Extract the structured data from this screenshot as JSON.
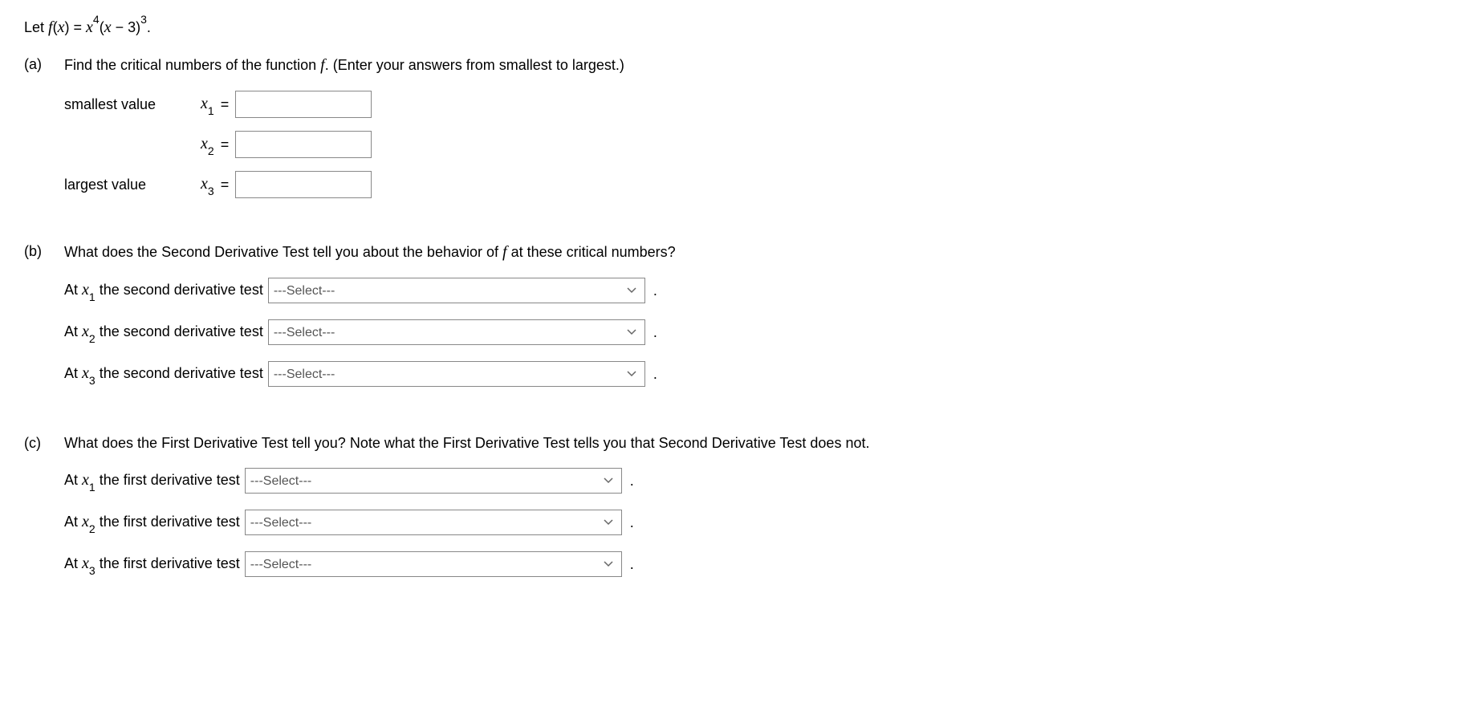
{
  "intro": {
    "let": "Let ",
    "f": "f",
    "x": "x",
    "eq": " = ",
    "exp1": "4",
    "lparen": "(",
    "minus": " − 3)",
    "exp2": "3",
    "dot": "."
  },
  "parts": {
    "a": {
      "label": "(a)",
      "question_pre": "Find the critical numbers of the function ",
      "question_post": ". (Enter your answers from smallest to largest.)",
      "smallest": "smallest value",
      "largest": "largest value",
      "x": "x",
      "sub1": "1",
      "sub2": "2",
      "sub3": "3",
      "eq": "="
    },
    "b": {
      "label": "(b)",
      "question_pre": "What does the Second Derivative Test tell you about the behavior of ",
      "question_post": " at these critical numbers?",
      "at": "At ",
      "x": "x",
      "sub1": "1",
      "sub2": "2",
      "sub3": "3",
      "text": " the second derivative test",
      "select_placeholder": "---Select---",
      "period": "."
    },
    "c": {
      "label": "(c)",
      "question": "What does the First Derivative Test tell you? Note what the First Derivative Test tells you that Second Derivative Test does not.",
      "at": "At ",
      "x": "x",
      "sub1": "1",
      "sub2": "2",
      "sub3": "3",
      "text": " the first derivative test",
      "select_placeholder": "---Select---",
      "period": "."
    }
  }
}
